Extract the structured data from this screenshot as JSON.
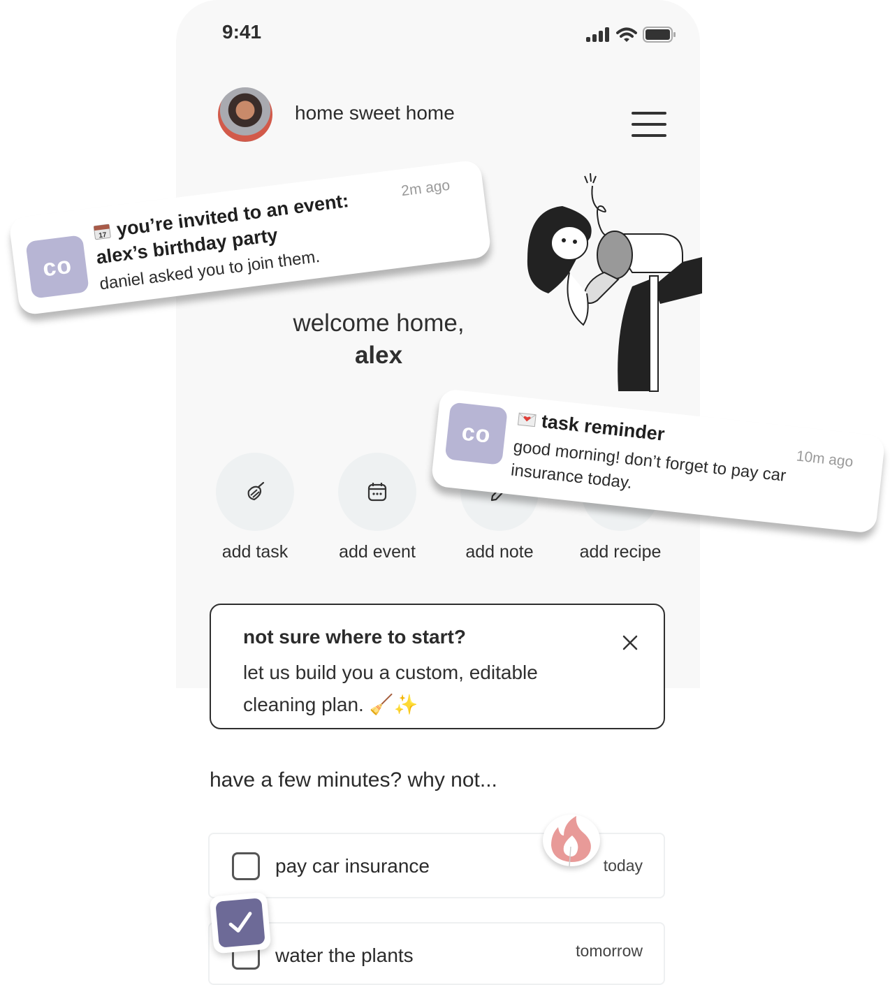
{
  "status_bar": {
    "time": "9:41",
    "icons": [
      "signal-icon",
      "wifi-icon",
      "battery-icon"
    ]
  },
  "header": {
    "title": "home sweet home",
    "avatar_alt": "user avatar",
    "menu_icon": "hamburger-menu-icon"
  },
  "welcome": {
    "line1": "welcome home,",
    "name": "alex"
  },
  "quick_actions": [
    {
      "label": "add task",
      "icon": "broom-icon"
    },
    {
      "label": "add event",
      "icon": "calendar-icon"
    },
    {
      "label": "add note",
      "icon": "pencil-icon"
    },
    {
      "label": "add recipe",
      "icon": "recipe-icon"
    }
  ],
  "tip_card": {
    "title": "not sure where to start?",
    "body": "let us build you a custom, editable cleaning plan. 🧹✨",
    "close_icon": "close-icon"
  },
  "suggestions": {
    "title": "have a few minutes? why not...",
    "tasks": [
      {
        "label": "pay car insurance",
        "due": "today",
        "checked": false
      },
      {
        "label": "water the plants",
        "due": "tomorrow",
        "checked": false
      }
    ]
  },
  "notifications": [
    {
      "app": "co",
      "emoji": "calendar-emoji",
      "title_line1": "you’re invited to an event:",
      "title_line2": "alex’s birthday party",
      "body": "daniel asked you to join them.",
      "time": "2m ago"
    },
    {
      "app": "co",
      "emoji": "love-letter-emoji",
      "title": "task reminder",
      "body_line1": "good morning! don’t forget to pay car",
      "body_line2": "insurance today.",
      "time": "10m ago"
    }
  ],
  "colors": {
    "app_icon_bg": "#b7b5d4",
    "check_sticker": "#6d6a97",
    "flame": "#e89a98",
    "action_circle": "#eef1f2",
    "phone_bg": "#f8f8f8"
  }
}
